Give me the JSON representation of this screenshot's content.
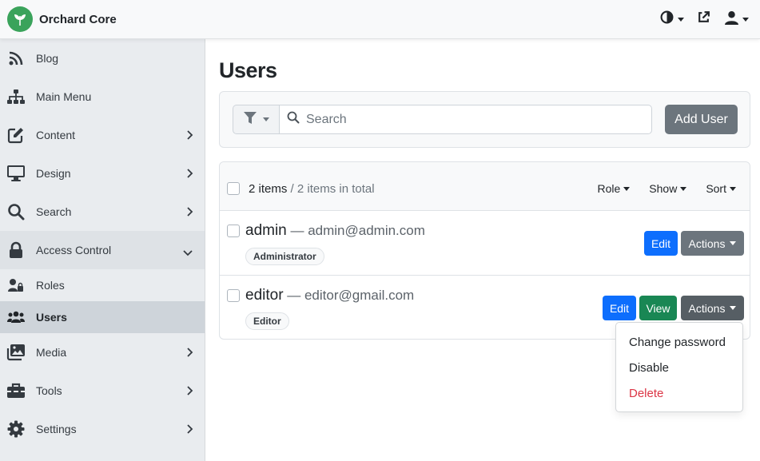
{
  "app": {
    "name": "Orchard Core",
    "brand_color": "#3aa35b"
  },
  "topbar": {
    "icons": [
      "theme-toggle-icon",
      "external-link-icon",
      "user-icon"
    ]
  },
  "sidebar": {
    "items": [
      {
        "label": "Blog",
        "icon": "rss-icon"
      },
      {
        "label": "Main Menu",
        "icon": "sitemap-icon"
      },
      {
        "label": "Content",
        "icon": "edit-icon"
      },
      {
        "label": "Design",
        "icon": "monitor-icon"
      },
      {
        "label": "Search",
        "icon": "search-icon"
      },
      {
        "label": "Access Control",
        "icon": "lock-icon"
      },
      {
        "label": "Media",
        "icon": "images-icon"
      },
      {
        "label": "Tools",
        "icon": "toolbox-icon"
      },
      {
        "label": "Settings",
        "icon": "gear-icon"
      }
    ],
    "access_control_sub": [
      {
        "label": "Roles",
        "icon": "user-lock-icon"
      },
      {
        "label": "Users",
        "icon": "users-icon"
      }
    ]
  },
  "page": {
    "title": "Users"
  },
  "filter": {
    "search_placeholder": "Search",
    "add_user_label": "Add User"
  },
  "list": {
    "count_selected": "2 items",
    "count_total": " / 2 items in total",
    "menus": {
      "role": "Role",
      "show": "Show",
      "sort": "Sort"
    },
    "rows": [
      {
        "username": "admin",
        "email": " — admin@admin.com",
        "role": "Administrator"
      },
      {
        "username": "editor",
        "email": " — editor@gmail.com",
        "role": "Editor"
      }
    ],
    "buttons": {
      "edit": "Edit",
      "view": "View",
      "actions": "Actions"
    }
  },
  "actions_dropdown": {
    "items": [
      "Change password",
      "Disable",
      "Delete"
    ]
  }
}
